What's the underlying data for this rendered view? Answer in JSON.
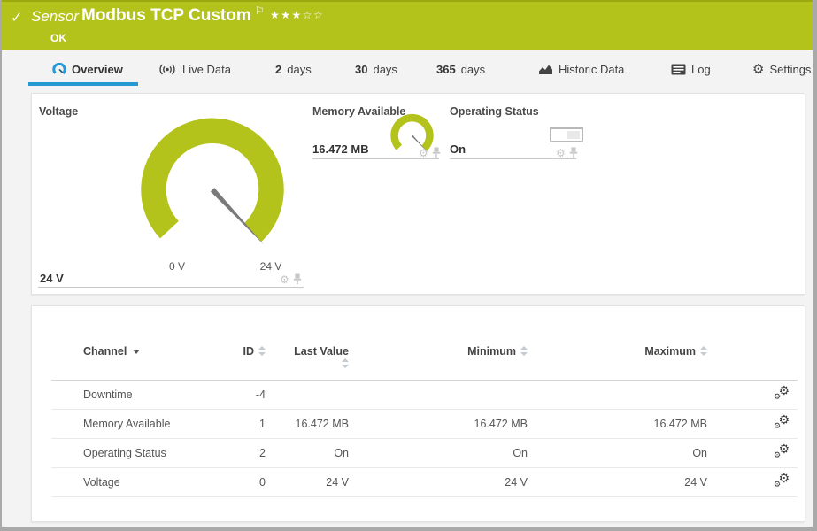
{
  "colors": {
    "ok_green": "#b4c31c",
    "tab_blue": "#2499d4",
    "needle_gray": "#7a7a7a",
    "light_icon": "#c6c6c6"
  },
  "header": {
    "check_icon": "✓",
    "kind": "Sensor",
    "title": "Modbus TCP Custom",
    "flag_icon": "⚐",
    "stars_filled": "★★★",
    "stars_empty": "☆☆",
    "status": "OK"
  },
  "tabs": {
    "overview": "Overview",
    "live_data": "Live Data",
    "d2_num": "2",
    "d2_label": "days",
    "d30_num": "30",
    "d30_label": "days",
    "d365_num": "365",
    "d365_label": "days",
    "historic": "Historic Data",
    "log": "Log",
    "settings": "Settings",
    "settings_gear": "⚙"
  },
  "gauges": {
    "voltage": {
      "title": "Voltage",
      "value": "24 V",
      "scale_min": "0 V",
      "scale_max": "24 V"
    },
    "memory": {
      "title": "Memory Available",
      "value": "16.472 MB"
    },
    "operating": {
      "title": "Operating Status",
      "value": "On"
    }
  },
  "icons": {
    "gear": "⚙"
  },
  "table": {
    "headers": {
      "channel": "Channel",
      "id": "ID",
      "last": "Last Value",
      "min": "Minimum",
      "max": "Maximum"
    },
    "rows": [
      {
        "channel": "Downtime",
        "id": "-4",
        "last": "",
        "min": "",
        "max": ""
      },
      {
        "channel": "Memory Available",
        "id": "1",
        "last": "16.472 MB",
        "min": "16.472 MB",
        "max": "16.472 MB"
      },
      {
        "channel": "Operating Status",
        "id": "2",
        "last": "On",
        "min": "On",
        "max": "On"
      },
      {
        "channel": "Voltage",
        "id": "0",
        "last": "24 V",
        "min": "24 V",
        "max": "24 V"
      }
    ]
  }
}
